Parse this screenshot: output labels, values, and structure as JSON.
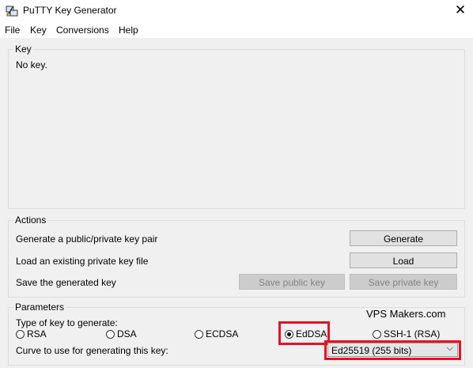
{
  "window": {
    "title": "PuTTY Key Generator",
    "close_glyph": "✕"
  },
  "menu": [
    "File",
    "Key",
    "Conversions",
    "Help"
  ],
  "key_section": {
    "legend": "Key",
    "status": "No key."
  },
  "actions": {
    "legend": "Actions",
    "generate_label": "Generate a public/private key pair",
    "load_label": "Load an existing private key file",
    "save_label": "Save the generated key",
    "generate_button": "Generate",
    "load_button": "Load",
    "save_public_button": "Save public key",
    "save_private_button": "Save private key"
  },
  "parameters": {
    "legend": "Parameters",
    "watermark": "VPS Makers.com",
    "type_label": "Type of key to generate:",
    "types": [
      {
        "label": "RSA",
        "selected": false
      },
      {
        "label": "DSA",
        "selected": false
      },
      {
        "label": "ECDSA",
        "selected": false
      },
      {
        "label": "EdDSA",
        "selected": true
      },
      {
        "label": "SSH-1 (RSA)",
        "selected": false
      }
    ],
    "curve_label": "Curve to use for generating this key:",
    "curve_value": "Ed25519 (255 bits)",
    "dropdown_glyph": "⌵"
  },
  "colors": {
    "highlight": "#e81123",
    "background": "#f0f0f0"
  }
}
